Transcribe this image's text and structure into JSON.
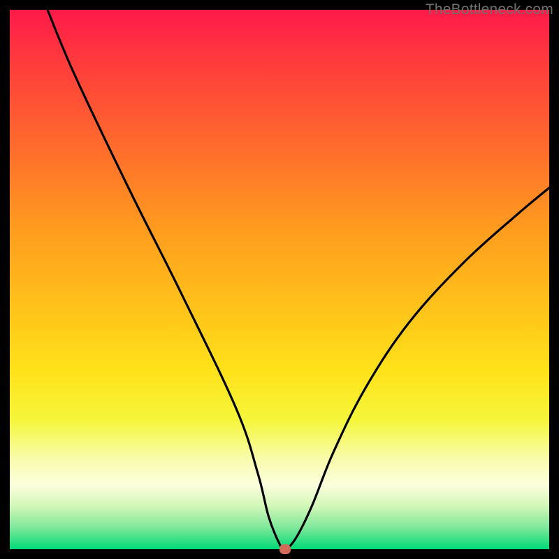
{
  "watermark": "TheBottleneck.com",
  "chart_data": {
    "type": "line",
    "title": "",
    "xlabel": "",
    "ylabel": "",
    "xlim": [
      0,
      100
    ],
    "ylim": [
      0,
      100
    ],
    "grid": false,
    "legend": false,
    "marker": {
      "x": 51,
      "y": 0,
      "color": "#d46a5a"
    },
    "series": [
      {
        "name": "curve",
        "x": [
          7,
          12,
          22,
          32,
          42,
          46,
          48,
          50,
          51,
          53,
          56,
          60,
          66,
          74,
          84,
          94,
          100
        ],
        "y": [
          100,
          88,
          67,
          47,
          26,
          14,
          6,
          1,
          0,
          2,
          8,
          18,
          30,
          42,
          53,
          62,
          67
        ]
      }
    ]
  },
  "frame": {
    "inner_size_px": 772,
    "border_px": 14
  }
}
